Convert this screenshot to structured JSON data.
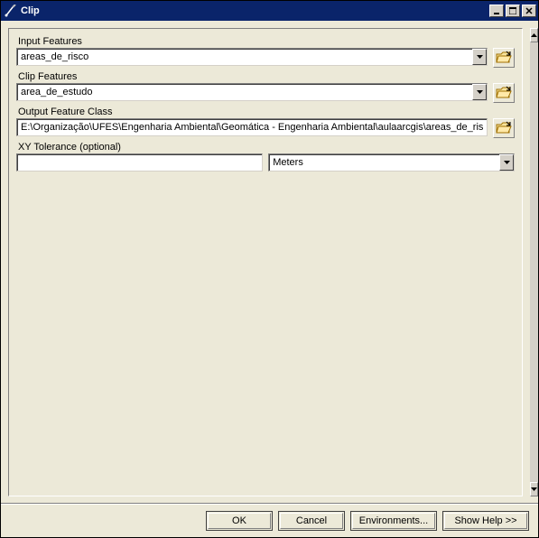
{
  "window": {
    "title": "Clip"
  },
  "fields": {
    "input_features": {
      "label": "Input Features",
      "value": "areas_de_risco"
    },
    "clip_features": {
      "label": "Clip Features",
      "value": "area_de_estudo"
    },
    "output_feature_class": {
      "label": "Output Feature Class",
      "value": "E:\\Organização\\UFES\\Engenharia Ambiental\\Geomática - Engenharia Ambiental\\aulaarcgis\\areas_de_ris"
    },
    "xy_tolerance": {
      "label": "XY Tolerance (optional)",
      "value": "",
      "units": "Meters"
    }
  },
  "buttons": {
    "ok": "OK",
    "cancel": "Cancel",
    "environments": "Environments...",
    "show_help": "Show Help >>"
  }
}
